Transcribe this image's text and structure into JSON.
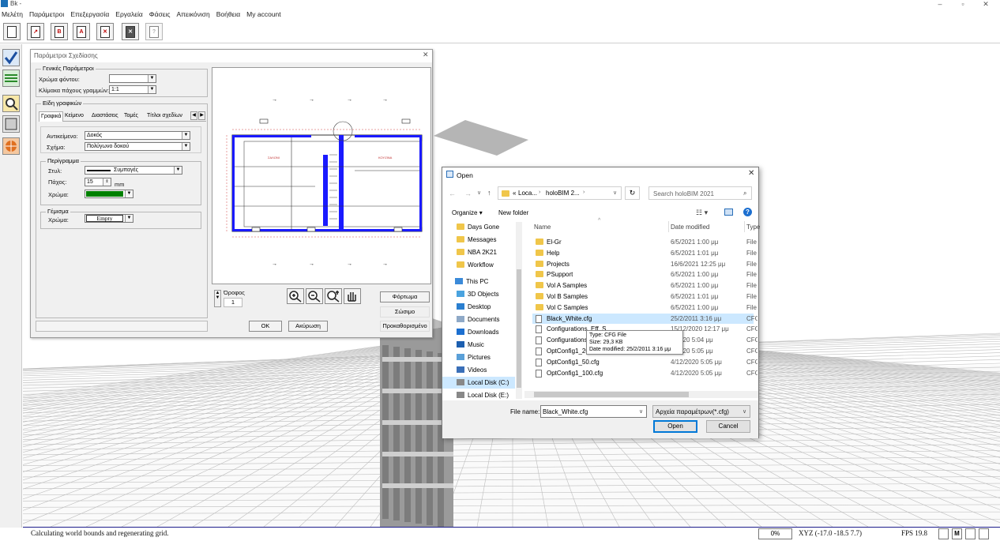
{
  "app": {
    "title": "Bk -"
  },
  "menu": [
    "Μελέτη",
    "Παράμετροι",
    "Επεξεργασία",
    "Εργαλεία",
    "Φάσεις",
    "Απεικόνιση",
    "Βοήθεια",
    "My account"
  ],
  "toolbar_icons": [
    "new-file-icon",
    "open-file-icon",
    "bold-b-icon",
    "text-a-icon",
    "delete-icon",
    "close-x-icon",
    "help-question-icon"
  ],
  "design_dialog": {
    "title": "Παράμετροι Σχεδίασης",
    "general_group": "Γενικές Παράμετροι",
    "bg_color_label": "Χρώμα φόντου:",
    "line_scale_label": "Κλίμακα πάχους γραμμών:",
    "line_scale_value": "1:1",
    "graphics_group": "Είδη γραφικών",
    "tabs": [
      "Γραφικά",
      "Κείμενο",
      "Διαστάσεις",
      "Τομές",
      "Τίτλοι σχεδίων"
    ],
    "object_label": "Αντικείμενο:",
    "object_value": "Δοκός",
    "shape_label": "Σχήμα:",
    "shape_value": "Πολύγωνο δοκού",
    "outline_group": "Περίγραμμα",
    "style_label": "Στυλ:",
    "style_value": "Συμπαγές",
    "thickness_label": "Πάχος:",
    "thickness_value": "15",
    "thickness_unit": "mm",
    "color_label": "Χρώμα:",
    "outline_color": "#008000",
    "fill_group": "Γέμισμα",
    "fill_color_label": "Χρώμα:",
    "fill_value": "Empty",
    "floor_label": "Όροφος",
    "floor_value": "1",
    "load_button": "Φόρτωμα",
    "save_button": "Σώσιμο",
    "ok_button": "OK",
    "cancel_button": "Ακύρωση",
    "default_button": "Προκαθορισμένο",
    "plan_labels": [
      "ΣΑΛΟΝΙ",
      "ΚΟΥΖΙΝΑ"
    ]
  },
  "open_dialog": {
    "title": "Open",
    "breadcrumb": [
      "Loca...",
      "holoBIM 2...",
      ""
    ],
    "breadcrumb_prefix": "«",
    "search_placeholder": "Search holoBIM 2021",
    "organize": "Organize",
    "new_folder": "New folder",
    "nav_quick": [
      "Days Gone",
      "Messages",
      "NBA 2K21",
      "Workflow"
    ],
    "nav_pc_label": "This PC",
    "nav_pc": [
      {
        "label": "3D Objects",
        "icon": "3d-objects-icon"
      },
      {
        "label": "Desktop",
        "icon": "desktop-icon"
      },
      {
        "label": "Documents",
        "icon": "documents-icon"
      },
      {
        "label": "Downloads",
        "icon": "downloads-icon"
      },
      {
        "label": "Music",
        "icon": "music-icon"
      },
      {
        "label": "Pictures",
        "icon": "pictures-icon"
      },
      {
        "label": "Videos",
        "icon": "videos-icon"
      },
      {
        "label": "Local Disk (C:)",
        "icon": "drive-icon"
      },
      {
        "label": "Local Disk (E:)",
        "icon": "drive-icon"
      }
    ],
    "columns": {
      "name": "Name",
      "date": "Date modified",
      "type": "Type"
    },
    "files": [
      {
        "name": "El-Gr",
        "date": "6/5/2021 1:00 μμ",
        "type": "File f",
        "kind": "folder"
      },
      {
        "name": "Help",
        "date": "6/5/2021 1:01 μμ",
        "type": "File f",
        "kind": "folder"
      },
      {
        "name": "Projects",
        "date": "16/6/2021 12:25 μμ",
        "type": "File f",
        "kind": "folder"
      },
      {
        "name": "PSupport",
        "date": "6/5/2021 1:00 μμ",
        "type": "File f",
        "kind": "folder"
      },
      {
        "name": "Vol A Samples",
        "date": "6/5/2021 1:00 μμ",
        "type": "File f",
        "kind": "folder"
      },
      {
        "name": "Vol B Samples",
        "date": "6/5/2021 1:01 μμ",
        "type": "File f",
        "kind": "folder"
      },
      {
        "name": "Vol C Samples",
        "date": "6/5/2021 1:00 μμ",
        "type": "File f",
        "kind": "folder"
      },
      {
        "name": "Black_White.cfg",
        "date": "25/2/2011 3:16 μμ",
        "type": "CFG",
        "kind": "file"
      },
      {
        "name": "Configurations_Eff_S...",
        "date": "15/12/2020 12:17 μμ",
        "type": "CFG",
        "kind": "file"
      },
      {
        "name": "Configurations_...",
        "date": "...2020 5:04 μμ",
        "type": "CFG",
        "kind": "file"
      },
      {
        "name": "OptConfig1_20...",
        "date": "...2020 5:05 μμ",
        "type": "CFG",
        "kind": "file"
      },
      {
        "name": "OptConfig1_50.cfg",
        "date": "4/12/2020 5:05 μμ",
        "type": "CFG",
        "kind": "file"
      },
      {
        "name": "OptConfig1_100.cfg",
        "date": "4/12/2020 5:05 μμ",
        "type": "CFG",
        "kind": "file"
      }
    ],
    "tooltip": {
      "type": "Type: CFG File",
      "size": "Size: 29,3 KB",
      "date": "Date modified: 25/2/2011 3:16 μμ"
    },
    "filename_label": "File name:",
    "filename_value": "Black_White.cfg",
    "filetype_value": "Αρχεία παραμέτρων(*.cfg)",
    "open_button": "Open",
    "cancel_button": "Cancel"
  },
  "status": {
    "message": "Calculating world bounds and regenerating grid.",
    "percent": "0%",
    "xyz": "XYZ (-17.0 -18.5 7.7)",
    "fps": "FPS 19.8",
    "indicators": [
      "M"
    ]
  },
  "colors": {
    "accent": "#0078d7",
    "selection": "#cce8ff",
    "grid": "#bdbdbd",
    "plan_wall": "#1a1aff"
  }
}
